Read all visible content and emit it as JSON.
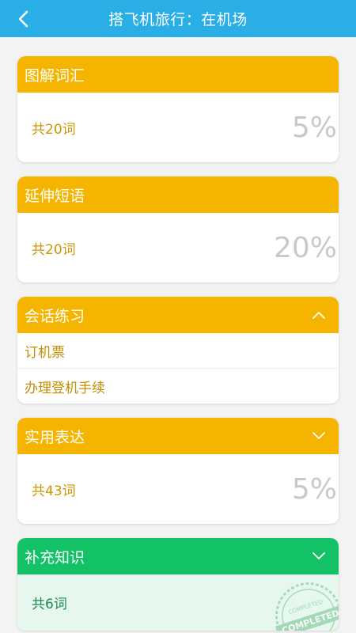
{
  "header": {
    "title": "搭飞机旅行：在机场"
  },
  "sections": [
    {
      "title": "图解词汇",
      "count": "共20词",
      "percent": "5%"
    },
    {
      "title": "延伸短语",
      "count": "共20词",
      "percent": "20%"
    },
    {
      "title": "会话练习",
      "expanded": true,
      "items": [
        "订机票",
        "办理登机手续"
      ]
    },
    {
      "title": "实用表达",
      "count": "共43词",
      "percent": "5%"
    },
    {
      "title": "补充知识",
      "count": "共6词",
      "stamp_text": "COMPLETED"
    }
  ],
  "colors": {
    "topbar": "#29aee6",
    "section_header": "#f4b400",
    "completed_header": "#13c266"
  },
  "icons": {
    "back": "chevron-left-icon",
    "expand": "chevron-down-icon",
    "collapse": "chevron-up-icon"
  }
}
